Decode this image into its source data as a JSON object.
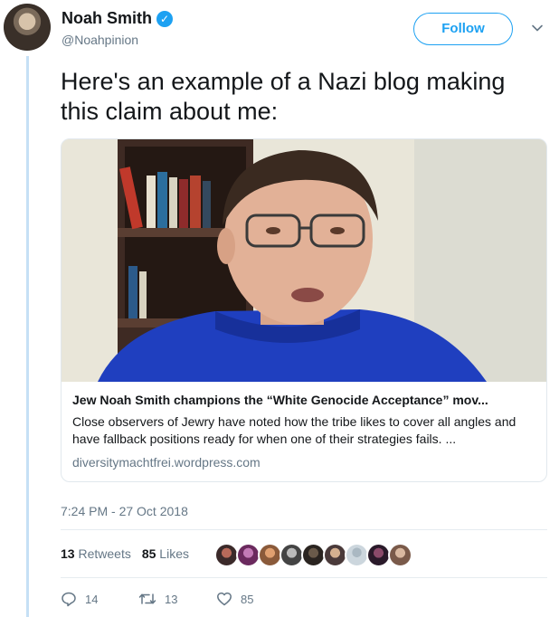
{
  "author": {
    "name": "Noah Smith",
    "handle": "@Noahpinion",
    "verified": true
  },
  "follow_label": "Follow",
  "tweet_text": "Here's an example of a Nazi blog making this claim about me:",
  "card": {
    "title": "Jew Noah Smith champions the “White Genocide Acceptance” mov...",
    "description": "Close observers of Jewry have noted how the tribe likes to cover all angles and have fallback positions ready for when one of their strategies fails. ...",
    "domain": "diversitymachtfrei.wordpress.com"
  },
  "timestamp": "7:24 PM - 27 Oct 2018",
  "stats": {
    "retweets_count": "13",
    "retweets_label": "Retweets",
    "likes_count": "85",
    "likes_label": "Likes"
  },
  "actions": {
    "replies": "14",
    "retweets": "13",
    "likes": "85"
  },
  "colors": {
    "accent": "#1da1f2",
    "muted": "#657786",
    "thread_line": "#c6e0f5"
  }
}
